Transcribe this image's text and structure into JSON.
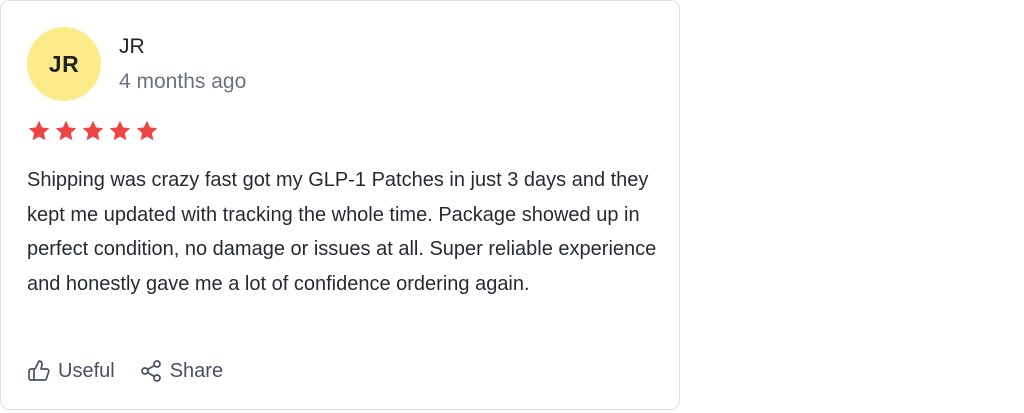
{
  "review": {
    "avatar_initials": "JR",
    "avatar_color": "#fdeb8a",
    "author": "JR",
    "date": "4 months ago",
    "rating": 5,
    "star_color": "#ef4444",
    "text": "Shipping was crazy fast got my GLP-1 Patches in just 3 days and they kept me updated with tracking the whole time. Package showed up in perfect condition, no damage or issues at all. Super reliable experience and honestly gave me a lot of confidence ordering again.",
    "actions": {
      "useful_label": "Useful",
      "useful_icon": "thumbs-up-icon",
      "share_label": "Share",
      "share_icon": "share-icon"
    }
  }
}
